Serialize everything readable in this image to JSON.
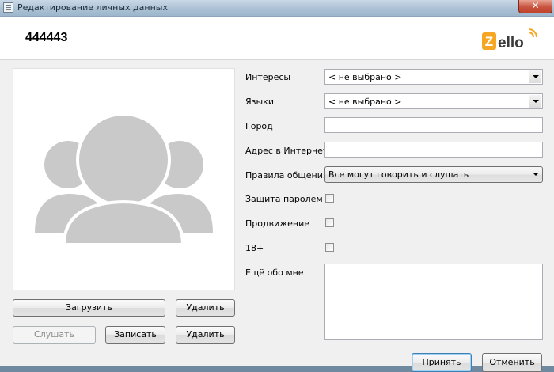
{
  "window": {
    "title": "Редактирование личных данных",
    "close_label": "✕"
  },
  "header": {
    "username": "444443",
    "logo_text": "Zello",
    "brand_color": "#f5a623"
  },
  "photo": {
    "upload_label": "Загрузить",
    "delete_label": "Удалить"
  },
  "audio": {
    "listen_label": "Слушать",
    "record_label": "Записать",
    "delete_label": "Удалить"
  },
  "form": {
    "interests": {
      "label": "Интересы",
      "value": "< не выбрано >"
    },
    "languages": {
      "label": "Языки",
      "value": "< не выбрано >"
    },
    "city": {
      "label": "Город",
      "value": ""
    },
    "website": {
      "label": "Адрес в Интернете",
      "value": ""
    },
    "rules": {
      "label": "Правила общения",
      "value": "Все могут говорить и слушать"
    },
    "password_protection": {
      "label": "Защита паролем",
      "checked": false
    },
    "promotion": {
      "label": "Продвижение",
      "checked": false
    },
    "adult": {
      "label": "18+",
      "checked": false
    },
    "about": {
      "label": "Ещё обо мне",
      "value": ""
    }
  },
  "footer": {
    "accept_label": "Принять",
    "cancel_label": "Отменить"
  }
}
